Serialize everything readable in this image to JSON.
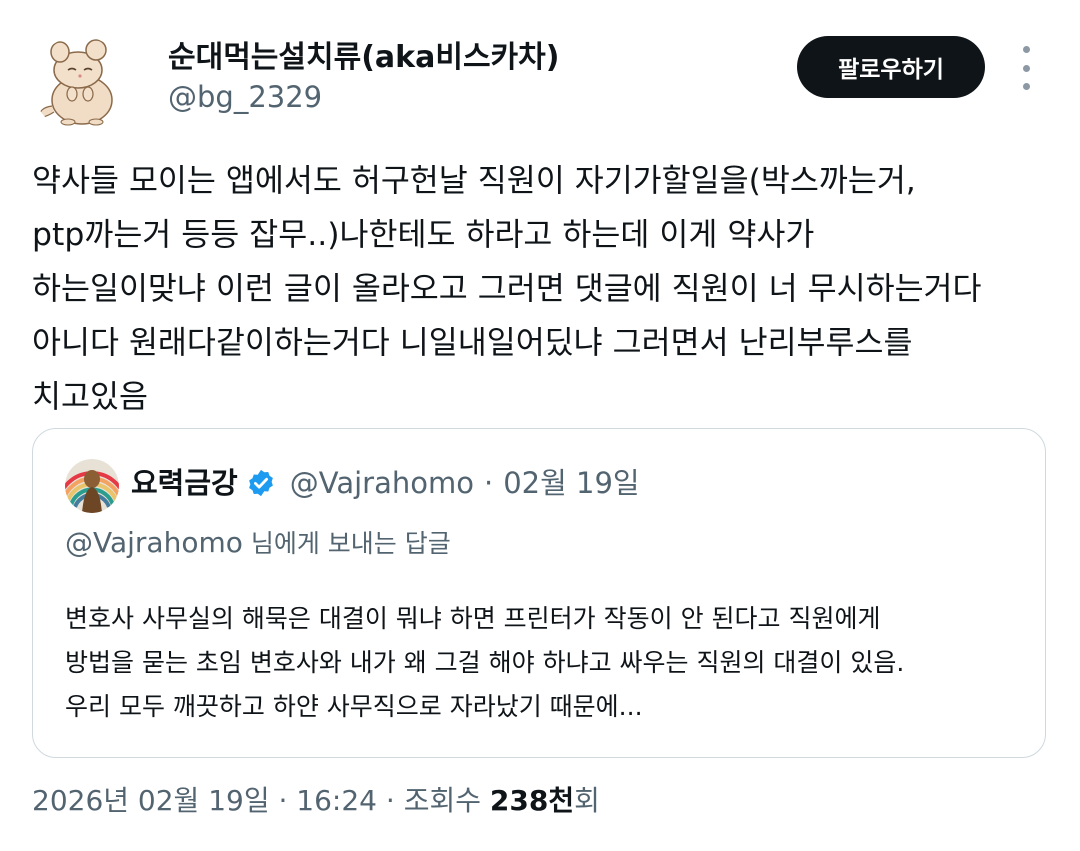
{
  "author": {
    "display_name": "순대먹는설치류(aka비스카차)",
    "handle": "@bg_2329",
    "avatar_icon": "chinchilla-avatar"
  },
  "actions": {
    "follow_label": "팔로우하기",
    "more_icon": "more-vertical-icon"
  },
  "tweet": {
    "text": "약사들 모이는 앱에서도 허구헌날 직원이 자기가할일을(박스까는거,\nptp까는거 등등 잡무..)나한테도 하라고 하는데 이게 약사가\n하는일이맞냐 이런 글이 올라오고 그러면 댓글에 직원이 너 무시하는거다\n아니다 원래다같이하는거다 니일내일어딨냐 그러면서 난리부루스를\n치고있음"
  },
  "quote": {
    "display_name": "요력금강",
    "verified_icon": "verified-badge-icon",
    "handle": "@Vajrahomo",
    "separator": "·",
    "date": "02월 19일",
    "reply_handle": "@Vajrahomo",
    "reply_suffix": " 님에게 보내는 답글",
    "text": "변호사 사무실의 해묵은 대결이 뭐냐 하면 프린터가 작동이 안 된다고 직원에게\n방법을 묻는 초임 변호사와 내가 왜 그걸 해야 하냐고 싸우는 직원의 대결이 있음.\n우리 모두 깨끗하고 하얀 사무직으로 자라났기 때문에..."
  },
  "meta": {
    "datetime": "2026년 02월 19일 · 16:24 · 조회수 ",
    "views_count": "238천",
    "views_suffix": "회"
  },
  "colors": {
    "text_primary": "#0f1419",
    "text_secondary": "#536471",
    "border": "#cfd9de",
    "follow_bg": "#0f1419",
    "verified": "#1d9bf0"
  }
}
